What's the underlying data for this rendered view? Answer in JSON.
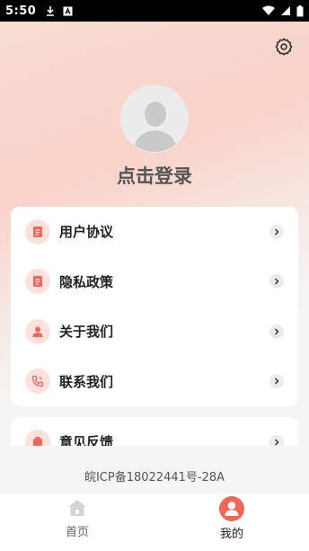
{
  "status_bar": {
    "time": "5:50",
    "icons": [
      "download-icon",
      "font-a-icon",
      "wifi-icon",
      "signal-icon",
      "battery-icon"
    ]
  },
  "header": {
    "settings_icon": "gear-icon",
    "avatar_icon": "default-avatar-icon",
    "login_label": "点击登录"
  },
  "menu": {
    "items": [
      {
        "label": "用户协议",
        "icon": "document-icon"
      },
      {
        "label": "隐私政策",
        "icon": "document-icon"
      },
      {
        "label": "关于我们",
        "icon": "person-icon"
      },
      {
        "label": "联系我们",
        "icon": "phone-icon"
      }
    ],
    "second_card_items": [
      {
        "label": "意见反馈",
        "icon": "feedback-icon"
      }
    ]
  },
  "footer": {
    "icp": "皖ICP备18022441号-28A"
  },
  "tabbar": {
    "tabs": [
      {
        "label": "首页",
        "icon": "home-icon",
        "active": false
      },
      {
        "label": "我的",
        "icon": "user-icon",
        "active": true
      }
    ]
  },
  "colors": {
    "accent": "#f0675a",
    "icon_bg": "#fde1dc",
    "gradient_top": "#f9d2c8"
  }
}
